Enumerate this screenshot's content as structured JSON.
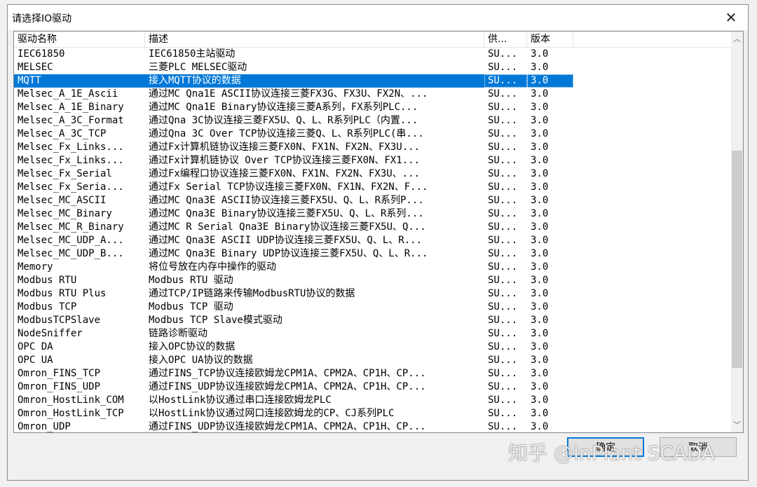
{
  "window": {
    "title": "请选择IO驱动",
    "close_glyph": "✕"
  },
  "columns": [
    "驱动名称",
    "描述",
    "供...",
    "版本"
  ],
  "rows": [
    {
      "name": "IEC61850",
      "desc": "IEC61850主站驱动",
      "vendor": "SU...",
      "version": "3.0"
    },
    {
      "name": "MELSEC",
      "desc": "三菱PLC MELSEC驱动",
      "vendor": "SU...",
      "version": "3.0"
    },
    {
      "name": "MQTT",
      "desc": "接入MQTT协议的数据",
      "vendor": "SU...",
      "version": "3.0",
      "selected": true
    },
    {
      "name": "Melsec_A_1E_Ascii",
      "desc": "通过MC Qna1E ASCII协议连接三菱FX3G、FX3U、FX2N、...",
      "vendor": "SU...",
      "version": "3.0"
    },
    {
      "name": "Melsec_A_1E_Binary",
      "desc": "通过MC Qna1E Binary协议连接三菱A系列，FX系列PLC...",
      "vendor": "SU...",
      "version": "3.0"
    },
    {
      "name": "Melsec_A_3C_Format",
      "desc": "通过Qna 3C协议连接三菱FX5U、Q、L、R系列PLC（内置...",
      "vendor": "SU...",
      "version": "3.0"
    },
    {
      "name": "Melsec_A_3C_TCP",
      "desc": "通过Qna 3C Over TCP协议连接三菱Q、L、R系列PLC(串...",
      "vendor": "SU...",
      "version": "3.0"
    },
    {
      "name": "Melsec_Fx_Links...",
      "desc": "通过Fx计算机链协议连接三菱FX0N、FX1N、FX2N、FX3U...",
      "vendor": "SU...",
      "version": "3.0"
    },
    {
      "name": "Melsec_Fx_Links...",
      "desc": "通过Fx计算机链协议 Over TCP协议连接三菱FX0N、FX1...",
      "vendor": "SU...",
      "version": "3.0"
    },
    {
      "name": "Melsec_Fx_Serial",
      "desc": "通过Fx编程口协议连接三菱FX0N、FX1N、FX2N、FX3U、...",
      "vendor": "SU...",
      "version": "3.0"
    },
    {
      "name": "Melsec_Fx_Seria...",
      "desc": "通过Fx Serial TCP协议连接三菱FX0N、FX1N、FX2N、F...",
      "vendor": "SU...",
      "version": "3.0"
    },
    {
      "name": "Melsec_MC_ASCII",
      "desc": "通过MC Qna3E ASCII协议连接三菱FX5U、Q、L、R系列P...",
      "vendor": "SU...",
      "version": "3.0"
    },
    {
      "name": "Melsec_MC_Binary",
      "desc": "通过MC Qna3E Binary协议连接三菱FX5U、Q、L、R系列...",
      "vendor": "SU...",
      "version": "3.0"
    },
    {
      "name": "Melsec_MC_R_Binary",
      "desc": "通过MC R Serial Qna3E Binary协议连接三菱FX5U、Q...",
      "vendor": "SU...",
      "version": "3.0"
    },
    {
      "name": "Melsec_MC_UDP_A...",
      "desc": "通过MC Qna3E ASCII UDP协议连接三菱FX5U、Q、L、R...",
      "vendor": "SU...",
      "version": "3.0"
    },
    {
      "name": "Melsec_MC_UDP_B...",
      "desc": "通过MC Qna3E Binary UDP协议连接三菱FX5U、Q、L、R...",
      "vendor": "SU...",
      "version": "3.0"
    },
    {
      "name": "Memory",
      "desc": "将位号放在内存中操作的驱动",
      "vendor": "SU...",
      "version": "3.0"
    },
    {
      "name": "Modbus RTU",
      "desc": "Modbus RTU 驱动",
      "vendor": "SU...",
      "version": "3.0"
    },
    {
      "name": "Modbus RTU Plus",
      "desc": "通过TCP/IP链路来传输ModbusRTU协议的数据",
      "vendor": "SU...",
      "version": "3.0"
    },
    {
      "name": "Modbus TCP",
      "desc": "Modbus TCP 驱动",
      "vendor": "SU...",
      "version": "3.0"
    },
    {
      "name": "ModbusTCPSlave",
      "desc": "Modbus TCP Slave模式驱动",
      "vendor": "SU...",
      "version": "3.0"
    },
    {
      "name": "NodeSniffer",
      "desc": "链路诊断驱动",
      "vendor": "SU...",
      "version": "3.0"
    },
    {
      "name": "OPC DA",
      "desc": "接入OPC协议的数据",
      "vendor": "SU...",
      "version": "3.0"
    },
    {
      "name": "OPC UA",
      "desc": "接入OPC UA协议的数据",
      "vendor": "SU...",
      "version": "3.0"
    },
    {
      "name": "Omron_FINS_TCP",
      "desc": "通过FINS_TCP协议连接欧姆龙CPM1A、CPM2A、CP1H、CP...",
      "vendor": "SU...",
      "version": "3.0"
    },
    {
      "name": "Omron_FINS_UDP",
      "desc": "通过FINS_UDP协议连接欧姆龙CPM1A、CPM2A、CP1H、CP...",
      "vendor": "SU...",
      "version": "3.0"
    },
    {
      "name": "Omron_HostLink_COM",
      "desc": "以HostLink协议通过串口连接欧姆龙PLC",
      "vendor": "SU...",
      "version": "3.0"
    },
    {
      "name": "Omron_HostLink_TCP",
      "desc": "以HostLink协议通过网口连接欧姆龙的CP、CJ系列PLC",
      "vendor": "SU...",
      "version": "3.0"
    },
    {
      "name": "Omron_UDP",
      "desc": "通过FINS_UDP协议连接欧姆龙CPM1A、CPM2A、CP1H、CP...",
      "vendor": "SU...",
      "version": "3.0"
    }
  ],
  "buttons": {
    "ok": "确定",
    "cancel": "取消"
  },
  "watermark": "知乎 @InPlant SCADA",
  "colors": {
    "selection": "#0078d7"
  }
}
